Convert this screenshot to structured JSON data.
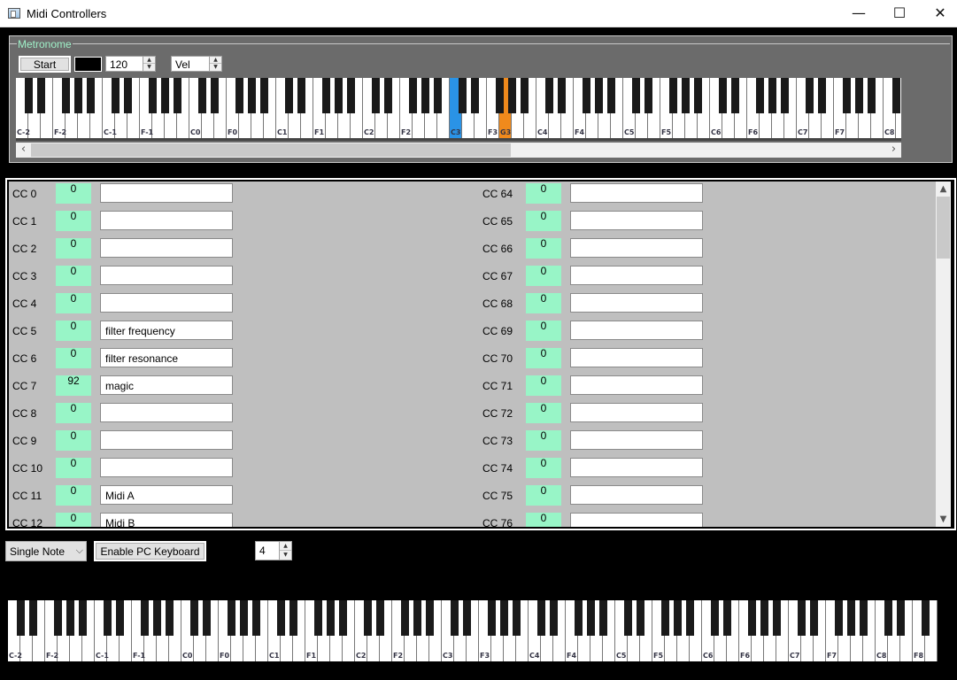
{
  "window": {
    "title": "Midi Controllers",
    "minimize_glyph": "—",
    "maximize_glyph": "☐",
    "close_glyph": "✕"
  },
  "metronome": {
    "legend": "Metronome",
    "start_label": "Start",
    "swatch_color": "#000000",
    "bpm_value": "120",
    "velocity_value": "Vel"
  },
  "top_keyboard": {
    "labels": [
      "C-2",
      "F-2",
      "C-1",
      "F-1",
      "C0",
      "F0",
      "C1",
      "F1",
      "C2",
      "F2",
      "C3",
      "F3",
      "G3",
      "C4",
      "F4",
      "C5",
      "F5",
      "C6",
      "F6",
      "C7",
      "F7",
      "C8"
    ],
    "highlighted_keys": [
      {
        "note": "C3",
        "color": "#2a93e6"
      },
      {
        "note": "G3",
        "color": "#f08a1c"
      }
    ]
  },
  "cc_left": [
    {
      "label": "CC 0",
      "value": "0",
      "name": ""
    },
    {
      "label": "CC 1",
      "value": "0",
      "name": ""
    },
    {
      "label": "CC 2",
      "value": "0",
      "name": ""
    },
    {
      "label": "CC 3",
      "value": "0",
      "name": ""
    },
    {
      "label": "CC 4",
      "value": "0",
      "name": ""
    },
    {
      "label": "CC 5",
      "value": "0",
      "name": "filter frequency"
    },
    {
      "label": "CC 6",
      "value": "0",
      "name": "filter resonance"
    },
    {
      "label": "CC 7",
      "value": "92",
      "name": "magic"
    },
    {
      "label": "CC 8",
      "value": "0",
      "name": ""
    },
    {
      "label": "CC 9",
      "value": "0",
      "name": ""
    },
    {
      "label": "CC 10",
      "value": "0",
      "name": ""
    },
    {
      "label": "CC 11",
      "value": "0",
      "name": "Midi A"
    },
    {
      "label": "CC 12",
      "value": "0",
      "name": "Midi B"
    }
  ],
  "cc_right": [
    {
      "label": "CC 64",
      "value": "0",
      "name": ""
    },
    {
      "label": "CC 65",
      "value": "0",
      "name": ""
    },
    {
      "label": "CC 66",
      "value": "0",
      "name": ""
    },
    {
      "label": "CC 67",
      "value": "0",
      "name": ""
    },
    {
      "label": "CC 68",
      "value": "0",
      "name": ""
    },
    {
      "label": "CC 69",
      "value": "0",
      "name": ""
    },
    {
      "label": "CC 70",
      "value": "0",
      "name": ""
    },
    {
      "label": "CC 71",
      "value": "0",
      "name": ""
    },
    {
      "label": "CC 72",
      "value": "0",
      "name": ""
    },
    {
      "label": "CC 73",
      "value": "0",
      "name": ""
    },
    {
      "label": "CC 74",
      "value": "0",
      "name": ""
    },
    {
      "label": "CC 75",
      "value": "0",
      "name": ""
    },
    {
      "label": "CC 76",
      "value": "0",
      "name": ""
    }
  ],
  "controls": {
    "mode_value": "Single Note",
    "pc_keyboard_label": "Enable PC Keyboard",
    "octave_value": "4"
  },
  "bottom_keyboard": {
    "labels": [
      "C-2",
      "F-2",
      "C-1",
      "F-1",
      "C0",
      "F0",
      "C1",
      "F1",
      "C2",
      "F2",
      "C3",
      "F3",
      "C4",
      "F4",
      "C5",
      "F5",
      "C6",
      "F6",
      "C7",
      "F7",
      "C8",
      "F8"
    ]
  }
}
